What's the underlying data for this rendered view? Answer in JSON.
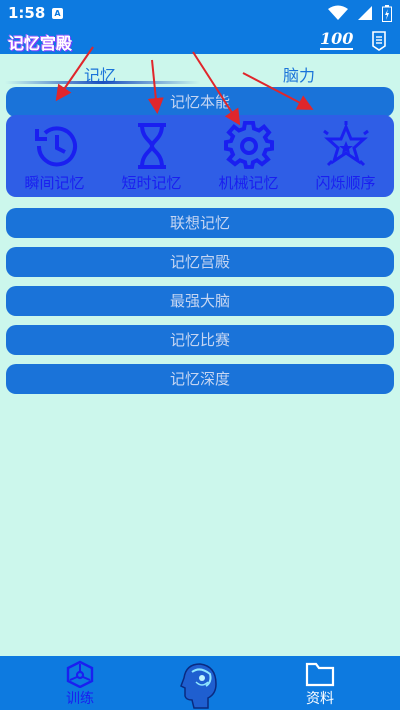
{
  "status_bar": {
    "time": "1:58",
    "notification_letter": "A"
  },
  "app_bar": {
    "title": "记忆宫殿",
    "score_badge": "100"
  },
  "tabs": [
    {
      "label": "记忆",
      "selected": true
    },
    {
      "label": "脑力",
      "selected": false
    }
  ],
  "menu": {
    "memory_basics": "记忆本能",
    "sub_items": [
      {
        "label": "瞬间记忆",
        "icon": "history-clock-icon"
      },
      {
        "label": "短时记忆",
        "icon": "hourglass-icon"
      },
      {
        "label": "机械记忆",
        "icon": "gear-icon"
      },
      {
        "label": "闪烁顺序",
        "icon": "sparkle-star-icon"
      }
    ],
    "association": "联想记忆",
    "palace": "记忆宫殿",
    "strongest_brain": "最强大脑",
    "competition": "记忆比赛",
    "depth": "记忆深度"
  },
  "bottom_nav": {
    "train": "训练",
    "data": "资料"
  },
  "colors": {
    "background": "#ccf7ec",
    "primary": "#0d7ae0",
    "button": "#1a73d9",
    "panel": "#2f5ee6",
    "selected_text": "#1a1ff0",
    "annotation_arrow": "#e0262b"
  }
}
